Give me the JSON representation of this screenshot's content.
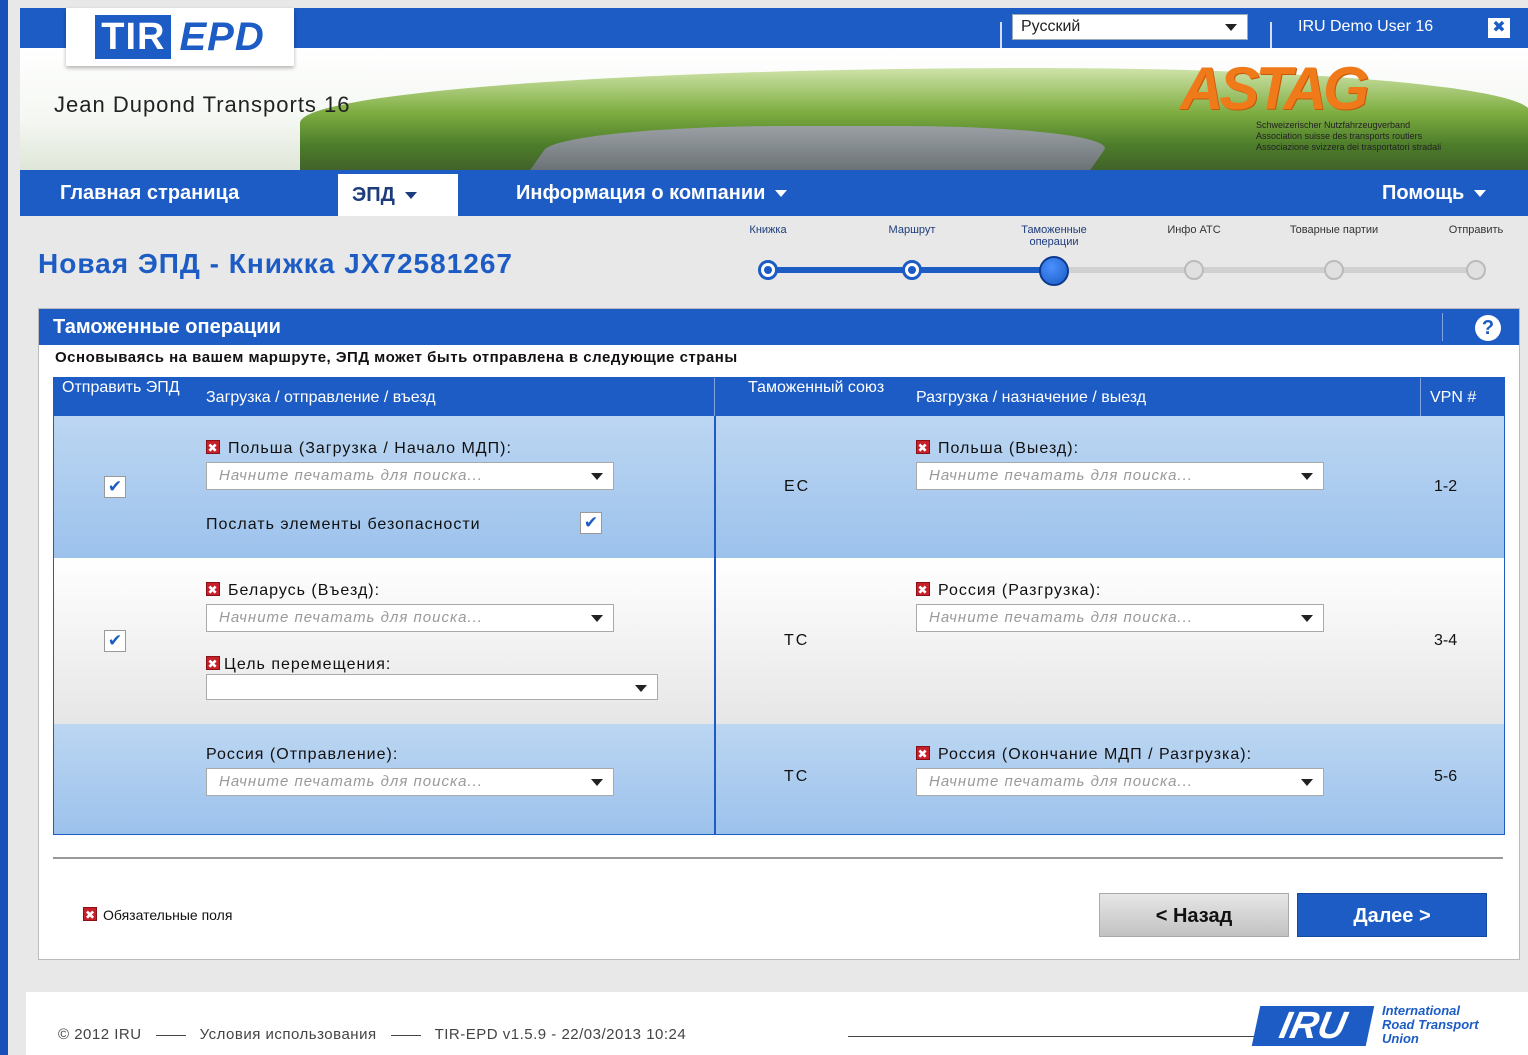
{
  "header": {
    "logo_tir": "TIR",
    "logo_epd": "EPD",
    "language": "Русский",
    "user": "IRU Demo User 16",
    "close_glyph": "✖",
    "company": "Jean Dupond Transports 16",
    "partner_logo": "ASTAG",
    "partner_subtitle": [
      "Schweizerischer Nutzfahrzeugverband",
      "Association suisse des transports routiers",
      "Associazione svizzera dei trasportatori stradali"
    ]
  },
  "nav": {
    "home": "Главная страница",
    "epd": "ЭПД",
    "company_info": "Информация о компании",
    "help": "Помощь"
  },
  "page_title": "Новая ЭПД - Книжка JX72581267",
  "steps": [
    {
      "label": "Книжка",
      "state": "done"
    },
    {
      "label": "Маршрут",
      "state": "done"
    },
    {
      "label": "Таможенные операции",
      "state": "current"
    },
    {
      "label": "Инфо АТС",
      "state": "future"
    },
    {
      "label": "Товарные партии",
      "state": "future"
    },
    {
      "label": "Отправить",
      "state": "future"
    }
  ],
  "panel": {
    "title": "Таможенные операции",
    "help_glyph": "?",
    "intro": "Основываясь на вашем маршруте, ЭПД может быть отправлена в следующие страны"
  },
  "table": {
    "headers": {
      "send": "Отправить ЭПД",
      "loading": "Загрузка / отправление / въезд",
      "customs_union": "Таможенный союз",
      "unloading": "Разгрузка / назначение / выезд",
      "vpn": "VPN #"
    },
    "placeholder": "Начните печатать для поиска...",
    "rows": [
      {
        "checked": "✔",
        "left_label": "Польша (Загрузка / Начало МДП):",
        "security_label": "Послать элементы безопасности",
        "security_checked": "✔",
        "customs_union": "ЕС",
        "right_label": "Польша (Выезд):",
        "vpn": "1-2"
      },
      {
        "checked": "✔",
        "left_label": "Беларусь (Въезд):",
        "purpose_label": "Цель перемещения:",
        "customs_union": "ТС",
        "right_label": "Россия (Разгрузка):",
        "vpn": "3-4"
      },
      {
        "left_label": "Россия (Отправление):",
        "customs_union": "ТС",
        "right_label": "Россия (Окончание МДП / Разгрузка):",
        "vpn": "5-6"
      }
    ]
  },
  "required_note": "Обязательные поля",
  "required_glyph": "✖",
  "buttons": {
    "back": "< Назад",
    "next": "Далее >"
  },
  "footer": {
    "copyright": "© 2012 IRU",
    "terms": "Условия использования",
    "version": "TIR-EPD v1.5.9 - 22/03/2013 10:24",
    "iru_logo": "IRU",
    "iru_name": [
      "International",
      "Road Transport",
      "Union"
    ]
  },
  "colors": {
    "primary": "#1c5cc4",
    "required": "#c8202a",
    "accent_orange": "#f07a1a"
  }
}
